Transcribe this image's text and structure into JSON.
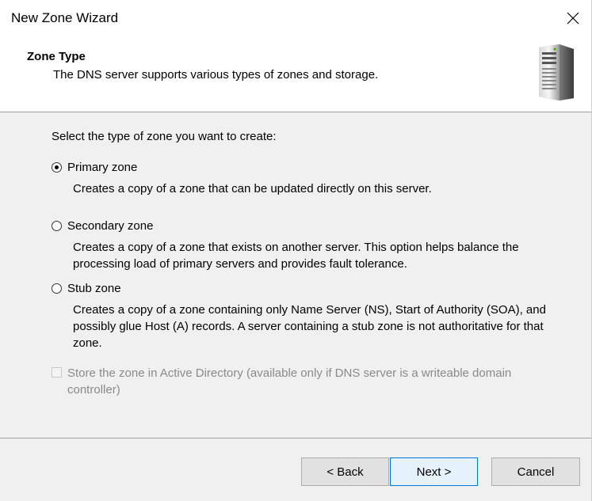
{
  "window": {
    "title": "New Zone Wizard"
  },
  "header": {
    "title": "Zone Type",
    "subtitle": "The DNS server supports various types of zones and storage."
  },
  "body": {
    "prompt": "Select the type of zone you want to create:",
    "options": [
      {
        "label": "Primary zone",
        "description": "Creates a copy of a zone that can be updated directly on this server.",
        "selected": true
      },
      {
        "label": "Secondary zone",
        "description": "Creates a copy of a zone that exists on another server. This option helps balance the processing load of primary servers and provides fault tolerance.",
        "selected": false
      },
      {
        "label": "Stub zone",
        "description": "Creates a copy of a zone containing only Name Server (NS), Start of Authority (SOA), and possibly glue Host (A) records. A server containing a stub zone is not authoritative for that zone.",
        "selected": false
      }
    ],
    "ad_checkbox": {
      "label": "Store the zone in Active Directory (available only if DNS server is a writeable domain controller)",
      "checked": false,
      "enabled": false
    }
  },
  "footer": {
    "back_label": "< Back",
    "next_label": "Next >",
    "cancel_label": "Cancel"
  },
  "icons": {
    "close": "close-icon",
    "header_image": "server-icon"
  },
  "colors": {
    "default_button_border": "#0078d7",
    "default_button_bg": "#e5f1fb",
    "disabled_text": "#8a8a8a"
  }
}
